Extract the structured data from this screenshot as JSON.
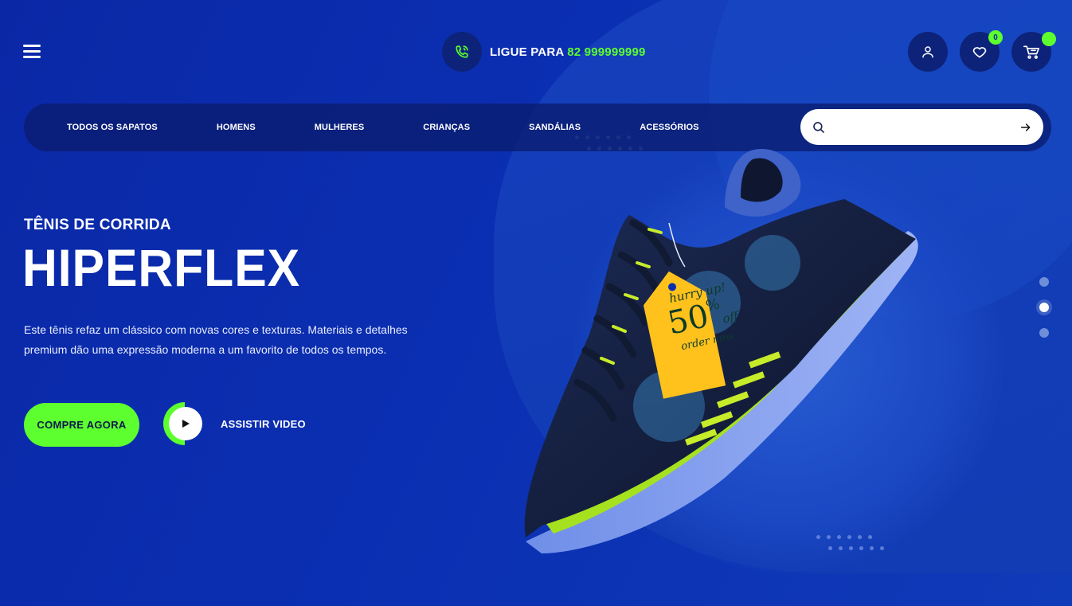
{
  "header": {
    "phone_prefix": "LIGUE PARA",
    "phone_number": "82 999999999",
    "wishlist_count": "0"
  },
  "nav": {
    "items": [
      {
        "label": "TODOS OS SAPATOS"
      },
      {
        "label": "HOMENS"
      },
      {
        "label": "MULHERES"
      },
      {
        "label": "CRIANÇAS"
      },
      {
        "label": "SANDÁLIAS"
      },
      {
        "label": "ACESSÓRIOS"
      }
    ],
    "search_placeholder": ""
  },
  "hero": {
    "subtitle": "TÊNIS DE CORRIDA",
    "title": "HIPERFLEX",
    "description": "Este tênis refaz um clássico com novas cores e texturas. Materiais e detalhes premium dão uma expressão moderna a um favorito de todos os tempos.",
    "buy_label": "COMPRE AGORA",
    "video_label": "ASSISTIR VIDEO"
  },
  "tag": {
    "line1": "hurry up!",
    "percent": "50",
    "pct_sign": "%",
    "off": "off",
    "line3": "order now"
  },
  "slider": {
    "count": 3,
    "active": 2
  },
  "colors": {
    "accent": "#5dff2e",
    "background": "#0a2aa0",
    "navbar": "#0a1c6e"
  },
  "icons": [
    "menu-icon",
    "phone-icon",
    "user-icon",
    "heart-icon",
    "cart-icon",
    "search-icon",
    "arrow-right-icon",
    "play-icon"
  ]
}
